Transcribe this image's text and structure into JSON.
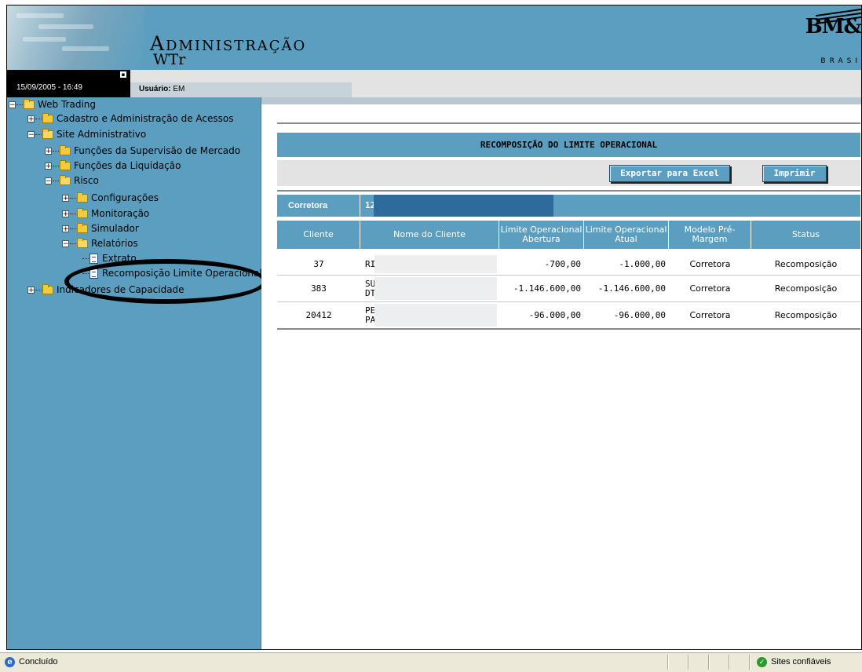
{
  "header": {
    "title": "Administração",
    "subtitle": "WTr",
    "logo_text": "BM&",
    "logo_subtext": "BRASI"
  },
  "infobar": {
    "datetime": "15/09/2005 - 16:49",
    "bullet": "▪",
    "user_label": "Usuário:",
    "user_value": "EM"
  },
  "tree": {
    "web_trading": "Web Trading",
    "cadastro": "Cadastro e Administração de Acessos",
    "site_admin": "Site Administrativo",
    "supervisao": "Funções da Supervisão de Mercado",
    "liquidacao": "Funções da Liquidação",
    "risco": "Risco",
    "configuracoes": "Configurações",
    "monitoracao": "Monitoração",
    "simulador": "Simulador",
    "relatorios": "Relatórios",
    "extrato": "Extrato",
    "recomposicao": "Recomposição Limite Operacional",
    "indicadores": "Indicadores de Capacidade"
  },
  "report": {
    "title": "RECOMPOSIÇÃO DO LIMITE OPERACIONAL",
    "export_button": "Exportar para Excel",
    "print_button": "Imprimir",
    "corretora_label": "Corretora",
    "corretora_value": "12",
    "headers": {
      "cliente": "Cliente",
      "nome": "Nome do Cliente",
      "abertura": "Limite Operacional Abertura",
      "atual": "Limite Operacional Atual",
      "modelo": "Modelo Pré-Margem",
      "status": "Status"
    },
    "rows": [
      {
        "cliente": "37",
        "nome": "RI",
        "abertura": "-700,00",
        "atual": "-1.000,00",
        "modelo": "Corretora",
        "status": "Recomposição"
      },
      {
        "cliente": "383",
        "nome": "SU\nDT",
        "abertura": "-1.146.600,00",
        "atual": "-1.146.600,00",
        "modelo": "Corretora",
        "status": "Recomposição"
      },
      {
        "cliente": "20412",
        "nome": "PE\nPA",
        "abertura": "-96.000,00",
        "atual": "-96.000,00",
        "modelo": "Corretora",
        "status": "Recomposição"
      }
    ]
  },
  "statusbar": {
    "status": "Concluído",
    "zone": "Sites confiáveis"
  },
  "colors": {
    "panel": "#5b9ec0",
    "gray": "#e3e3e3",
    "redaction": "#2f6a9c"
  }
}
